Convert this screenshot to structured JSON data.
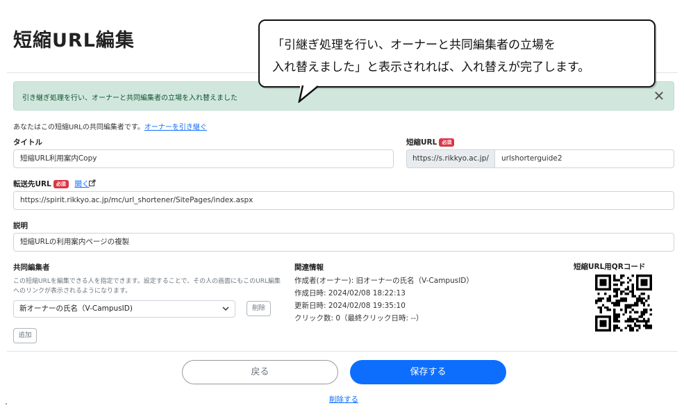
{
  "page": {
    "title": "短縮URL編集"
  },
  "alert": {
    "message": "引き継ぎ処理を行い、オーナーと共同編集者の立場を入れ替えました",
    "close_glyph": "✕"
  },
  "callout": {
    "line1": "「引継ぎ処理を行い、オーナーと共同編集者の立場を",
    "line2": "入れ替えました」と表示されれば、入れ替えが完了します。"
  },
  "co_editor_note": {
    "text": "あなたはこの短縮URLの共同編集者です。",
    "link": "オーナーを引き継ぐ"
  },
  "form": {
    "required_badge": "必須",
    "title_label": "タイトル",
    "title_value": "短縮URL利用案内Copy",
    "short_url_label": "短縮URL",
    "short_url_prefix": "https://s.rikkyo.ac.jp/",
    "short_url_slug": "urlshorterguide2",
    "dest_label": "転送先URL",
    "dest_open_link": "開く",
    "dest_value": "https://spirit.rikkyo.ac.jp/mc/url_shortener/SitePages/index.aspx",
    "desc_label": "説明",
    "desc_value": "短縮URLの利用案内ページの複製"
  },
  "co_editors": {
    "heading": "共同編集者",
    "help": "この短縮URLを編集できる人を指定できます。設定することで、その人の画面にもこのURL編集へのリンクが表示されるようになります。",
    "selected": "新オーナーの氏名（V-CampusID)",
    "delete_label": "削除",
    "add_label": "追加"
  },
  "related": {
    "heading": "関連情報",
    "owner": "作成者(オーナー): 旧オーナーの氏名（V-CampusID）",
    "created": "作成日時: 2024/02/08 18:22:13",
    "updated": "更新日時: 2024/02/08 19:35:10",
    "clicks": "クリック数: 0（最終クリック日時: --）"
  },
  "qr": {
    "label": "短縮URL用QRコード"
  },
  "actions": {
    "back_label": "戻る",
    "save_label": "保存する",
    "delete_label": "削除する"
  },
  "colors": {
    "primary": "#0d6efd",
    "alert_bg": "#d1e7dd",
    "required": "#dc3545"
  },
  "icons": {
    "close": "close-icon",
    "external": "external-link-icon",
    "chevron": "chevron-down-icon"
  }
}
